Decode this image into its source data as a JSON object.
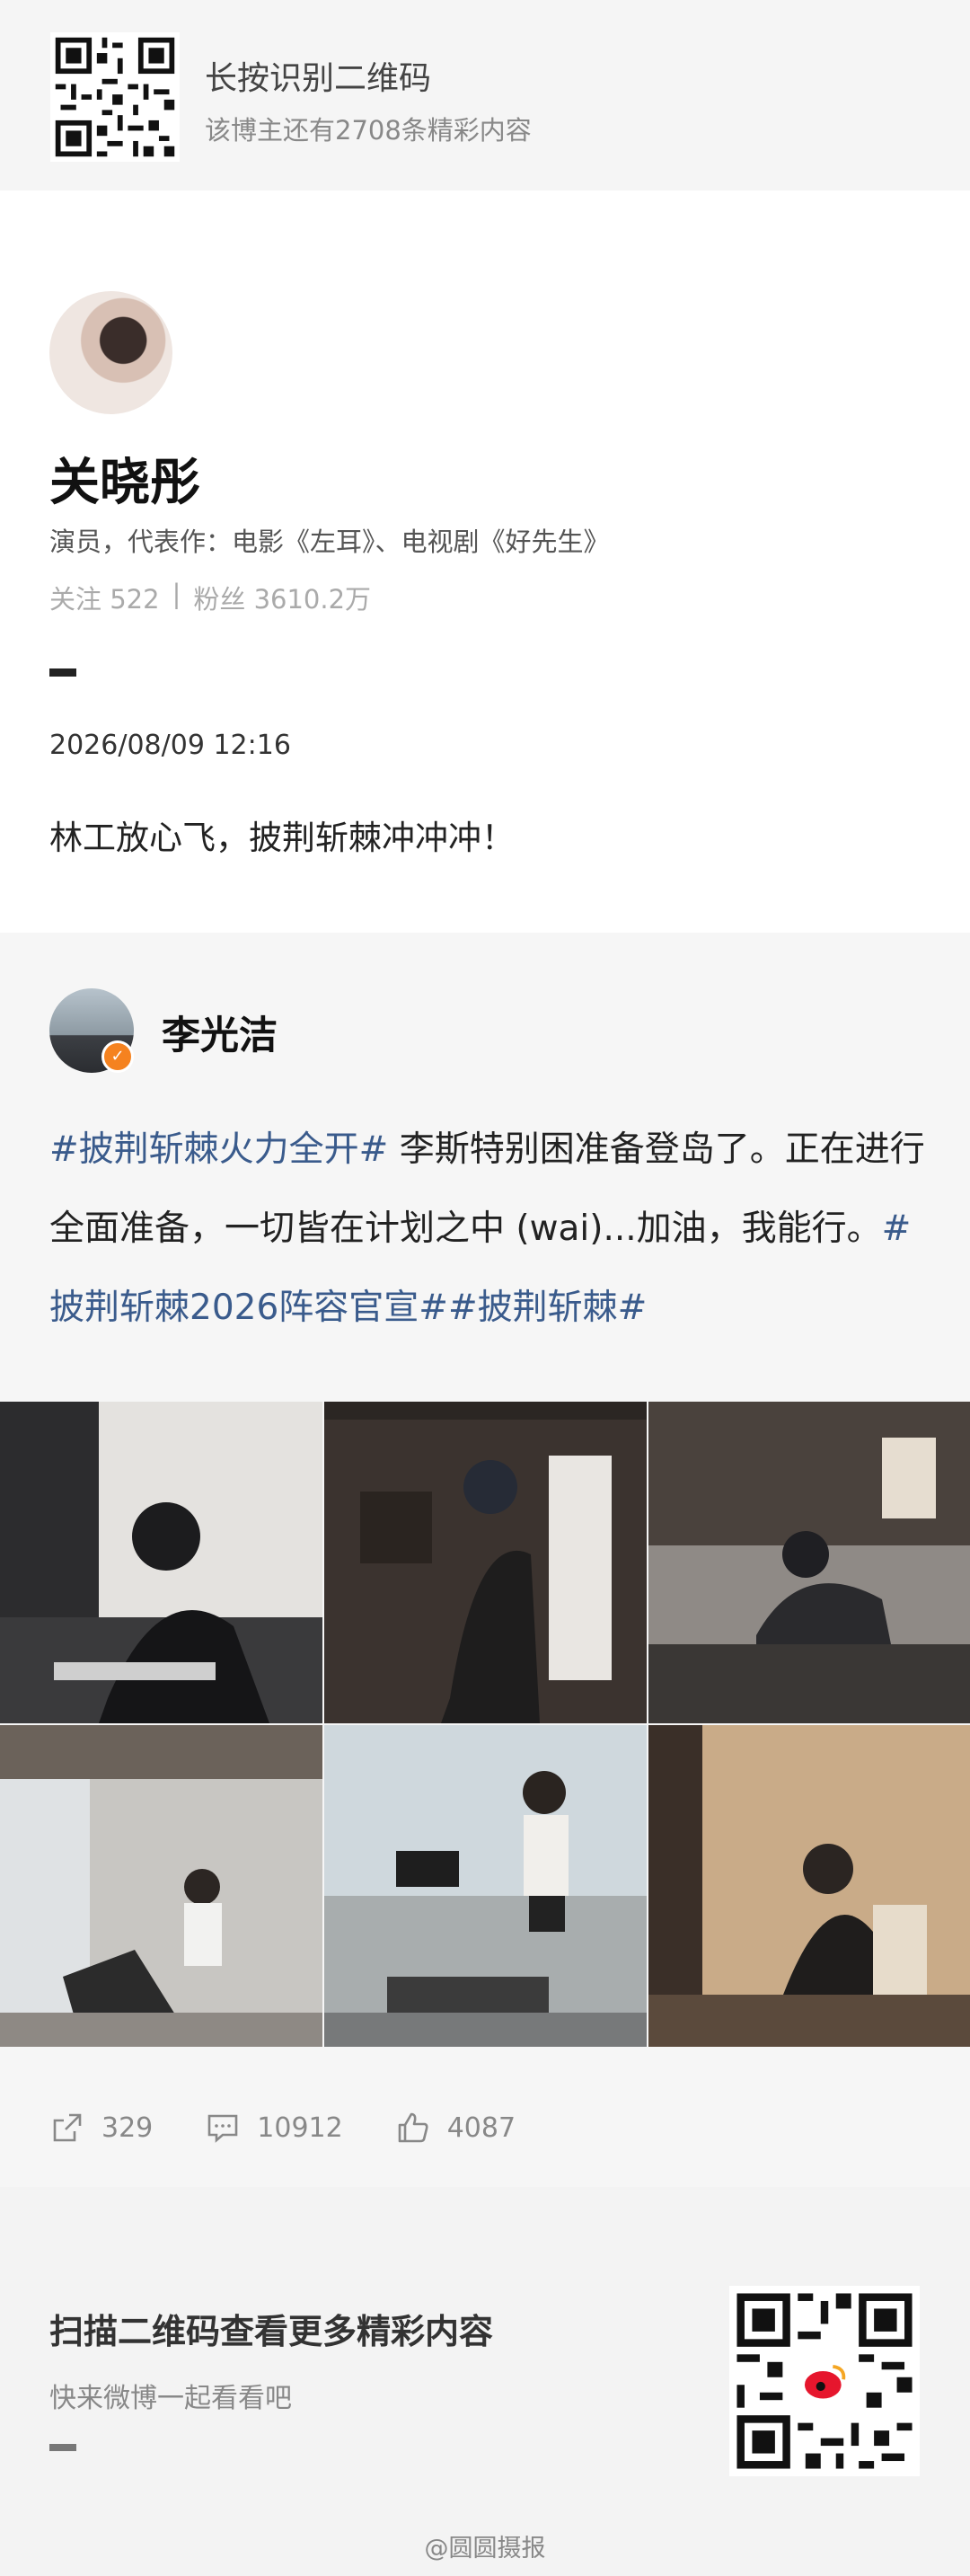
{
  "top_banner": {
    "title": "长按识别二维码",
    "subtitle": "该博主还有2708条精彩内容"
  },
  "profile": {
    "name": "关晓彤",
    "bio": "演员，代表作：电影《左耳》、电视剧《好先生》",
    "following_label": "关注 522",
    "separator": "|",
    "followers_label": "粉丝 3610.2万",
    "post_time": "2026/08/09 12:16",
    "post_text": "林工放心飞，披荆斩棘冲冲冲！"
  },
  "repost": {
    "author": "李光洁",
    "tag1": "#披荆斩棘火力全开#",
    "text1": " 李斯特别困准备登岛了。正在进行全面准备，一切皆在计划之中 (wai)...加油，我能行。",
    "tag2": "#披荆斩棘2026阵容官宣#",
    "tag3": "#披荆斩棘#",
    "photos": [
      "studio desk",
      "recording booth",
      "studio couch",
      "gym treadmills",
      "treadmill run",
      "vocal booth"
    ],
    "share_count": "329",
    "comment_count": "10912",
    "like_count": "4087"
  },
  "bottom": {
    "title": "扫描二维码查看更多精彩内容",
    "subtitle": "快来微博一起看看吧",
    "watermark": "@圆圆摄报"
  },
  "colors": {
    "hashtag": "#3a5b8c",
    "verified_badge": "#f5821f"
  }
}
